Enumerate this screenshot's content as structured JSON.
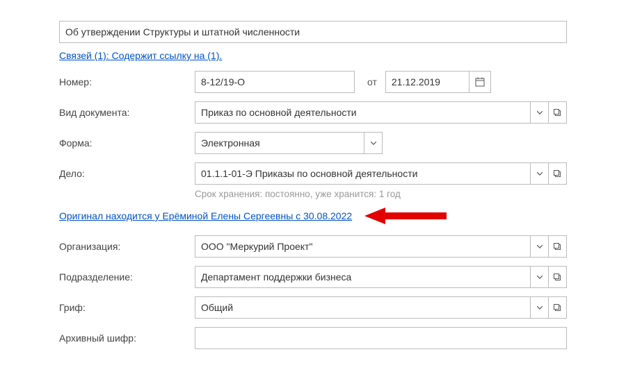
{
  "title": "Об утверждении Структуры и штатной численности",
  "links_text": "Связей (1): Содержит ссылку на (1).",
  "number_label": "Номер:",
  "number_value": "8-12/19-О",
  "ot_label": "от",
  "date_value": "21.12.2019",
  "doc_type_label": "Вид документа:",
  "doc_type_value": "Приказ по основной деятельности",
  "form_label": "Форма:",
  "form_value": "Электронная",
  "case_label": "Дело:",
  "case_value": "01.1.1-01-Э Приказы по основной деятельности",
  "retention_text": "Срок хранения: постоянно, уже хранится: 1 год",
  "original_link": "Оригинал находится у Ерёминой Елены Сергеевны с 30.08.2022",
  "org_label": "Организация:",
  "org_value": "ООО \"Меркурий Проект\"",
  "dept_label": "Подразделение:",
  "dept_value": "Департамент поддержки бизнеса",
  "stamp_label": "Гриф:",
  "stamp_value": "Общий",
  "arch_label": "Архивный шифр:",
  "arch_value": ""
}
